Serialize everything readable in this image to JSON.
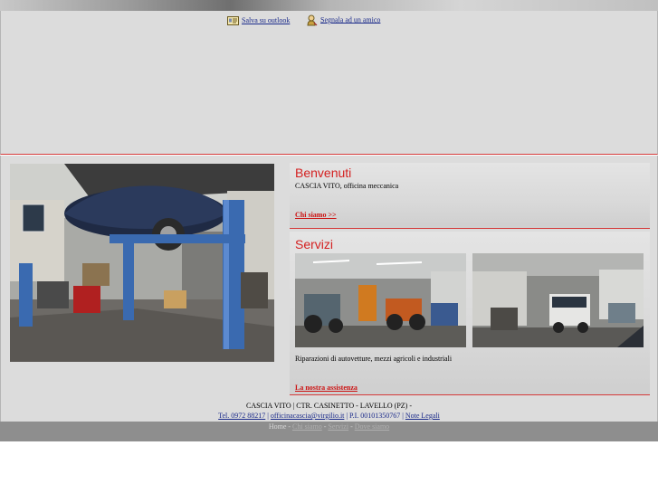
{
  "toplinks": {
    "outlook": "Salva su outlook",
    "friend": "Segnala ad un amico"
  },
  "welcome": {
    "title": "Benvenuti",
    "text": "CASCIA VITO, officina meccanica",
    "link": "Chi siamo >>"
  },
  "services": {
    "title": "Servizi",
    "text": "Riparazioni di autovetture, mezzi agricoli e industriali",
    "link": "La nostra assistenza"
  },
  "footer": {
    "address": "CASCIA VITO | CTR. CASINETTO - LAVELLO (PZ) -",
    "phone": "Tel. 0972 88217",
    "email": "officinacascia@virgilio.it",
    "vat": "P.I. 00101350767",
    "legal": "Note Legali",
    "sep": " | "
  },
  "nav": {
    "home": "Home",
    "about": "Chi siamo",
    "services": "Servizi",
    "where": "Dove siamo",
    "sep": " - "
  },
  "colors": {
    "accent": "#d42020",
    "link": "#1a2a8a",
    "background": "#dcdcdc"
  }
}
